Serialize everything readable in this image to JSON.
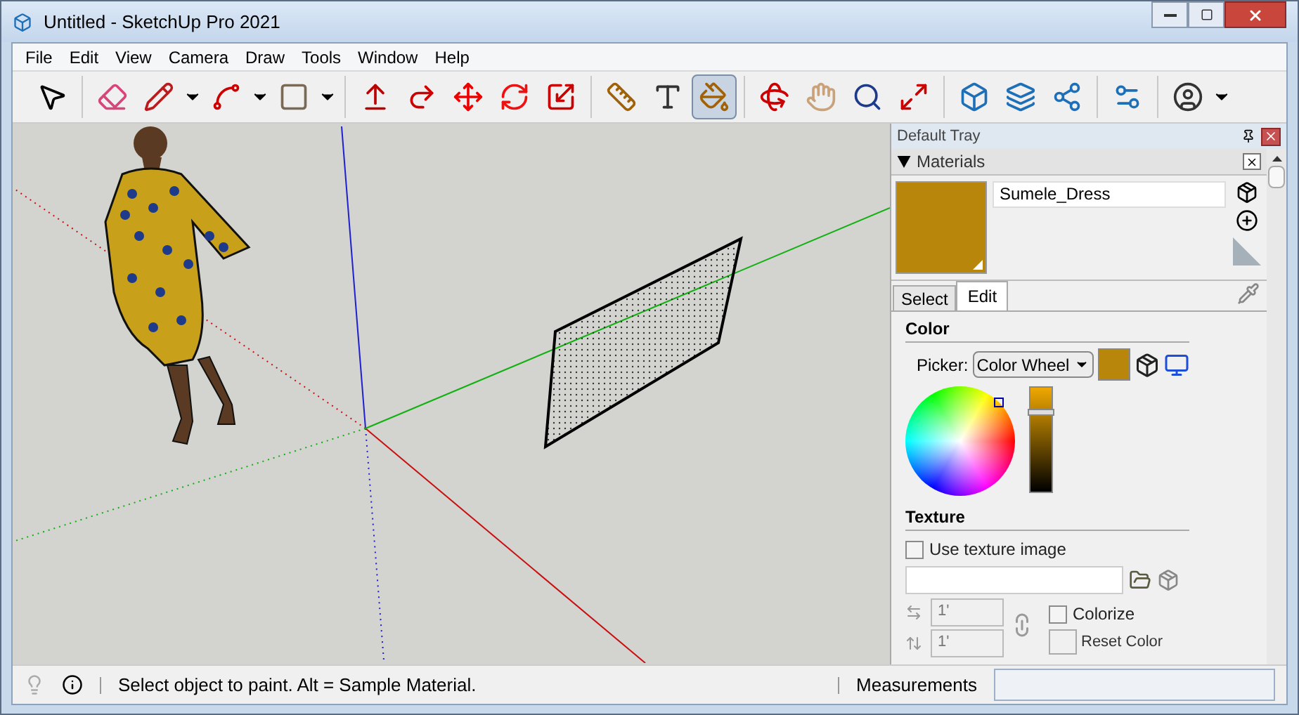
{
  "window": {
    "title": "Untitled - SketchUp Pro 2021"
  },
  "menu": [
    "File",
    "Edit",
    "View",
    "Camera",
    "Draw",
    "Tools",
    "Window",
    "Help"
  ],
  "toolbar": [
    {
      "kind": "select",
      "selected": false
    },
    {
      "kind": "eraser",
      "selected": false
    },
    {
      "kind": "pencil",
      "selected": false
    },
    {
      "kind": "arc",
      "selected": false
    },
    {
      "kind": "rectangle",
      "selected": false
    },
    {
      "kind": "pushpull",
      "selected": false
    },
    {
      "kind": "followme",
      "selected": false
    },
    {
      "kind": "move",
      "selected": false
    },
    {
      "kind": "rotate",
      "selected": false
    },
    {
      "kind": "scale",
      "selected": false
    },
    {
      "kind": "tape",
      "selected": false
    },
    {
      "kind": "text",
      "selected": false
    },
    {
      "kind": "paint",
      "selected": true
    },
    {
      "kind": "orbit",
      "selected": false
    },
    {
      "kind": "pan",
      "selected": false
    },
    {
      "kind": "zoom",
      "selected": false
    },
    {
      "kind": "extents",
      "selected": false
    },
    {
      "kind": "warehouse",
      "selected": false
    },
    {
      "kind": "extension",
      "selected": false
    },
    {
      "kind": "share",
      "selected": false
    },
    {
      "kind": "manager",
      "selected": false
    },
    {
      "kind": "account",
      "selected": false
    }
  ],
  "tray": {
    "title": "Default Tray",
    "materials": {
      "title": "Materials",
      "expanded": true,
      "name": "Sumele_Dress",
      "color": "#b8860b",
      "tabs": [
        {
          "label": "Select",
          "selected": false
        },
        {
          "label": "Edit",
          "selected": true
        }
      ],
      "color_section": {
        "title": "Color",
        "picker_label": "Picker:",
        "picker": "Color Wheel",
        "brightness": {
          "level": 0.78
        }
      },
      "texture_section": {
        "title": "Texture",
        "use_texture": {
          "label": "Use texture image",
          "checked": false
        },
        "width": "1'",
        "height": "1'",
        "colorize": {
          "label": "Colorize",
          "checked": false
        },
        "reset": "Reset Color"
      }
    }
  },
  "status_bar": {
    "message": "Select object to paint. Alt = Sample Material.",
    "measurements_label": "Measurements"
  }
}
